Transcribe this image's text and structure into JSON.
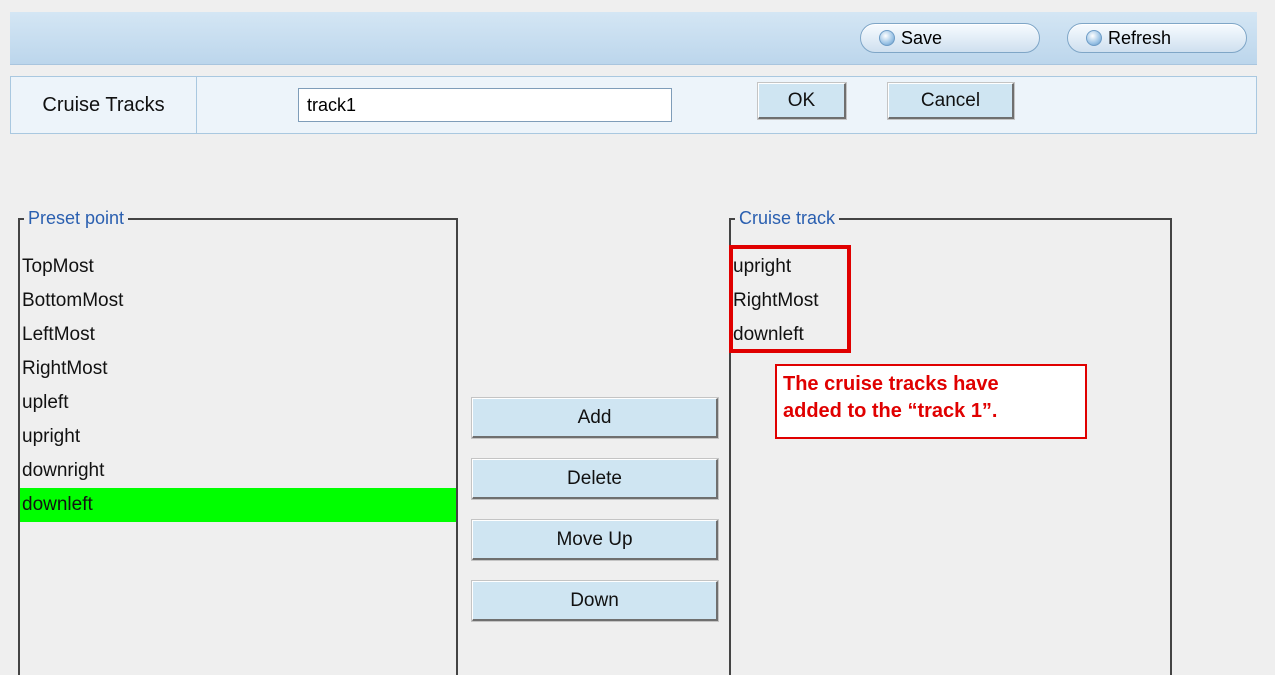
{
  "toolbar": {
    "save_label": "Save",
    "refresh_label": "Refresh"
  },
  "track_row": {
    "label": "Cruise Tracks",
    "track_name_value": "track1",
    "ok_label": "OK",
    "cancel_label": "Cancel"
  },
  "preset_panel": {
    "legend": "Preset point",
    "items": [
      "TopMost",
      "BottomMost",
      "LeftMost",
      "RightMost",
      "upleft",
      "upright",
      "downright",
      "downleft"
    ],
    "selected_item": "downleft"
  },
  "actions": {
    "add_label": "Add",
    "delete_label": "Delete",
    "move_up_label": "Move Up",
    "down_label": "Down"
  },
  "cruise_panel": {
    "legend": "Cruise track",
    "items": [
      "upright",
      "RightMost",
      "downleft"
    ]
  },
  "annotation": {
    "line1": "The cruise tracks have",
    "line2": "added to the “track 1”."
  },
  "colors": {
    "selected_highlight": "#00ff00",
    "annotation_red": "#e00000",
    "legend_blue": "#2a5fb0"
  },
  "icons": {
    "toolbar_button_icon": "refresh-circle-icon"
  }
}
